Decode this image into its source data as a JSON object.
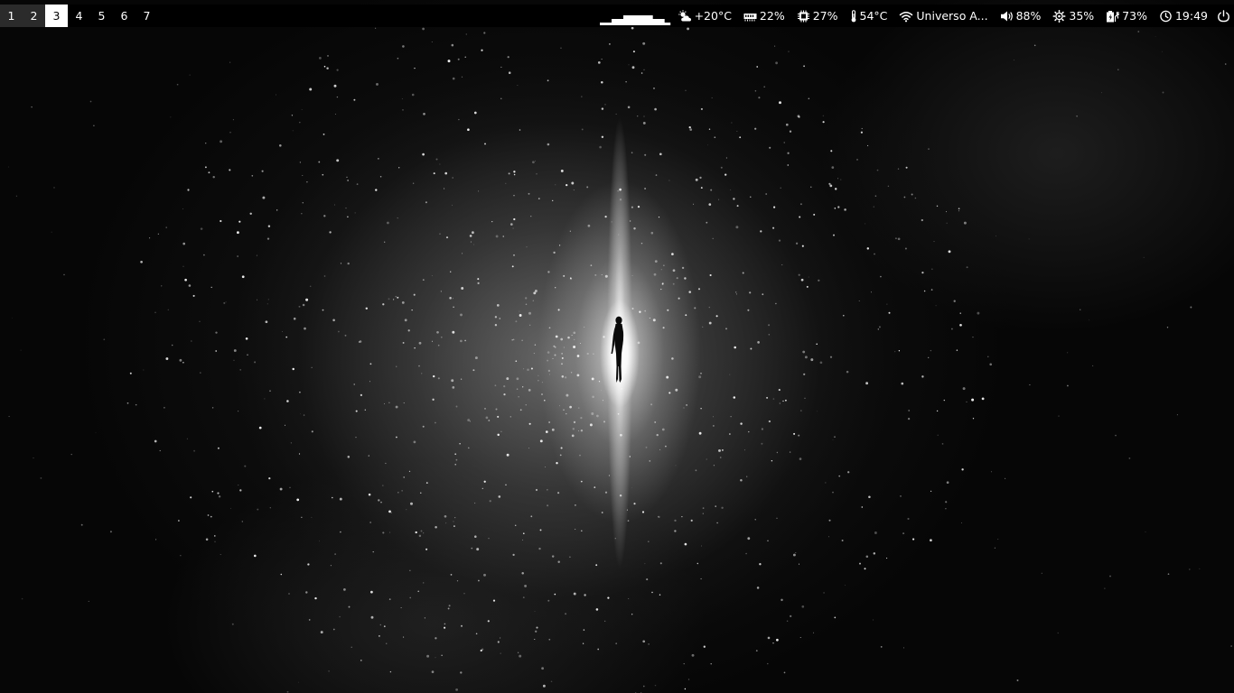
{
  "workspaces": [
    {
      "label": "1",
      "state": "occupied"
    },
    {
      "label": "2",
      "state": "occupied"
    },
    {
      "label": "3",
      "state": "active"
    },
    {
      "label": "4",
      "state": "empty"
    },
    {
      "label": "5",
      "state": "empty"
    },
    {
      "label": "6",
      "state": "empty"
    },
    {
      "label": "7",
      "state": "empty"
    }
  ],
  "activity_graph": {
    "icon": "activity-graph",
    "levels": [
      0.15,
      0.15,
      0.35,
      0.35,
      0.55,
      0.55,
      0.55,
      0.55,
      0.55,
      0.35,
      0.35,
      0.15
    ]
  },
  "status": {
    "weather": {
      "icon": "weather-partly-cloudy-icon",
      "text": "+20°C"
    },
    "memory": {
      "icon": "memory-icon",
      "text": "22%"
    },
    "cpu": {
      "icon": "cpu-icon",
      "text": "27%"
    },
    "temperature": {
      "icon": "thermometer-icon",
      "text": "54°C"
    },
    "network": {
      "icon": "wifi-icon",
      "text": "Universo A..."
    },
    "volume": {
      "icon": "volume-icon",
      "text": "88%"
    },
    "brightness": {
      "icon": "brightness-icon",
      "text": "35%"
    },
    "battery": {
      "icon": "battery-charging-icon",
      "text": "73%"
    },
    "clock": {
      "icon": "clock-icon",
      "text": "19:49"
    },
    "power": {
      "icon": "power-icon"
    }
  },
  "colors": {
    "bar_background": "#000000",
    "bar_text": "#ffffff",
    "workspace_active_bg": "#ffffff",
    "workspace_active_fg": "#000000",
    "workspace_occupied_bg": "#2b2b2b"
  },
  "wallpaper": {
    "subject": "silhouette-in-galaxy-light"
  }
}
